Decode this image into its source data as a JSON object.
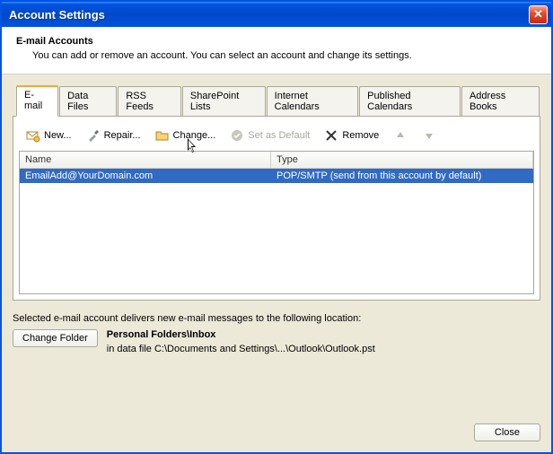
{
  "window": {
    "title": "Account Settings",
    "close_label": "✕"
  },
  "header": {
    "heading": "E-mail Accounts",
    "sub": "You can add or remove an account. You can select an account and change its settings."
  },
  "tabs": [
    {
      "label": "E-mail",
      "active": true
    },
    {
      "label": "Data Files"
    },
    {
      "label": "RSS Feeds"
    },
    {
      "label": "SharePoint Lists"
    },
    {
      "label": "Internet Calendars"
    },
    {
      "label": "Published Calendars"
    },
    {
      "label": "Address Books"
    }
  ],
  "toolbar": {
    "new_label": "New...",
    "repair_label": "Repair...",
    "change_label": "Change...",
    "set_default_label": "Set as Default",
    "remove_label": "Remove"
  },
  "list": {
    "columns": {
      "name": "Name",
      "type": "Type"
    },
    "rows": [
      {
        "name": "EmailAdd@YourDomain.com",
        "type": "POP/SMTP (send from this account by default)",
        "selected": true
      }
    ]
  },
  "delivery": {
    "intro": "Selected e-mail account delivers new e-mail messages to the following location:",
    "change_folder_label": "Change Folder",
    "folder_path": "Personal Folders\\Inbox",
    "data_file": "in data file C:\\Documents and Settings\\...\\Outlook\\Outlook.pst"
  },
  "footer": {
    "close_label": "Close"
  },
  "icons": {
    "new": "mail-new-icon",
    "repair": "tools-icon",
    "change": "folder-edit-icon",
    "set_default": "check-circle-icon",
    "remove": "x-icon",
    "up": "arrow-up-icon",
    "down": "arrow-down-icon"
  }
}
